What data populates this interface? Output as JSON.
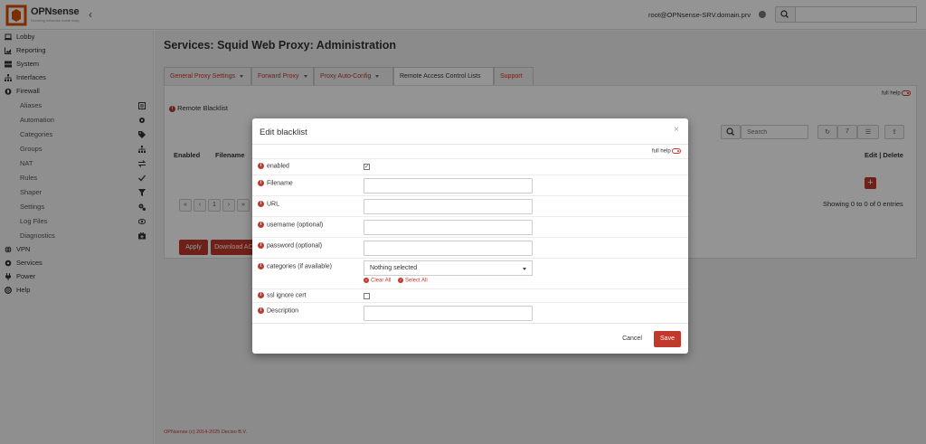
{
  "header": {
    "brand": "OPNsense",
    "tagline": "Securing networks made easy",
    "user": "root@OPNsense-SRV.domain.prv",
    "search_placeholder": ""
  },
  "sidebar": {
    "items": [
      {
        "label": "Lobby",
        "icon": "laptop-icon",
        "level": "top"
      },
      {
        "label": "Reporting",
        "icon": "area-chart-icon",
        "level": "top"
      },
      {
        "label": "System",
        "icon": "server-icon",
        "level": "top"
      },
      {
        "label": "Interfaces",
        "icon": "sitemap-icon",
        "level": "top"
      },
      {
        "label": "Firewall",
        "icon": "fire-icon",
        "level": "top"
      },
      {
        "label": "Aliases",
        "icon": "list-alt-icon",
        "level": "sub"
      },
      {
        "label": "Automation",
        "icon": "cog-icon",
        "level": "sub"
      },
      {
        "label": "Categories",
        "icon": "tags-icon",
        "level": "sub"
      },
      {
        "label": "Groups",
        "icon": "sitemap-icon",
        "level": "sub"
      },
      {
        "label": "NAT",
        "icon": "exchange-icon",
        "level": "sub"
      },
      {
        "label": "Rules",
        "icon": "check-icon",
        "level": "sub"
      },
      {
        "label": "Shaper",
        "icon": "filter-icon",
        "level": "sub"
      },
      {
        "label": "Settings",
        "icon": "cogs-icon",
        "level": "sub"
      },
      {
        "label": "Log Files",
        "icon": "eye-icon",
        "level": "sub"
      },
      {
        "label": "Diagnostics",
        "icon": "medkit-icon",
        "level": "sub"
      },
      {
        "label": "VPN",
        "icon": "globe-icon",
        "level": "top"
      },
      {
        "label": "Services",
        "icon": "cog-icon",
        "level": "top"
      },
      {
        "label": "Power",
        "icon": "plug-icon",
        "level": "top"
      },
      {
        "label": "Help",
        "icon": "life-ring-icon",
        "level": "top"
      }
    ]
  },
  "page": {
    "title": "Services: Squid Web Proxy: Administration",
    "tabs": [
      {
        "label": "General Proxy Settings",
        "dropdown": true,
        "active": false
      },
      {
        "label": "Forward Proxy",
        "dropdown": true,
        "active": false
      },
      {
        "label": "Proxy Auto-Config",
        "dropdown": true,
        "active": false
      },
      {
        "label": "Remote Access Control Lists",
        "dropdown": false,
        "active": true
      },
      {
        "label": "Support",
        "dropdown": false,
        "active": false
      }
    ],
    "full_help": "full help",
    "section_label": "Remote Blacklist",
    "search_placeholder": "Search",
    "rows_per_page": "7",
    "col_enabled": "Enabled",
    "col_filename": "Filename",
    "col_edit_delete": "Edit | Delete",
    "pager": [
      "«",
      "‹",
      "1",
      "›",
      "»"
    ],
    "showing": "Showing 0 to 0 of 0 entries",
    "apply_label": "Apply",
    "download_label": "Download ACLs",
    "footer": "OPNsense (c) 2014-2025 Deciso B.V."
  },
  "modal": {
    "title": "Edit blacklist",
    "close": "×",
    "full_help": "full help",
    "fields": {
      "enabled": {
        "label": "enabled",
        "checked": true
      },
      "filename": {
        "label": "Filename",
        "value": ""
      },
      "url": {
        "label": "URL",
        "value": ""
      },
      "username": {
        "label": "username (optional)",
        "value": ""
      },
      "password": {
        "label": "password (optional)",
        "value": ""
      },
      "categories": {
        "label": "categories (if available)",
        "value": "Nothing selected",
        "clear_all": "Clear All",
        "select_all": "Select All"
      },
      "ssl_ignore": {
        "label": "ssl ignore cert",
        "checked": false
      },
      "description": {
        "label": "Description",
        "value": ""
      }
    },
    "cancel_label": "Cancel",
    "save_label": "Save"
  },
  "colors": {
    "accent": "#c0392b",
    "overlay": "rgba(0,0,0,0.42)",
    "logo": "#d94f00"
  }
}
